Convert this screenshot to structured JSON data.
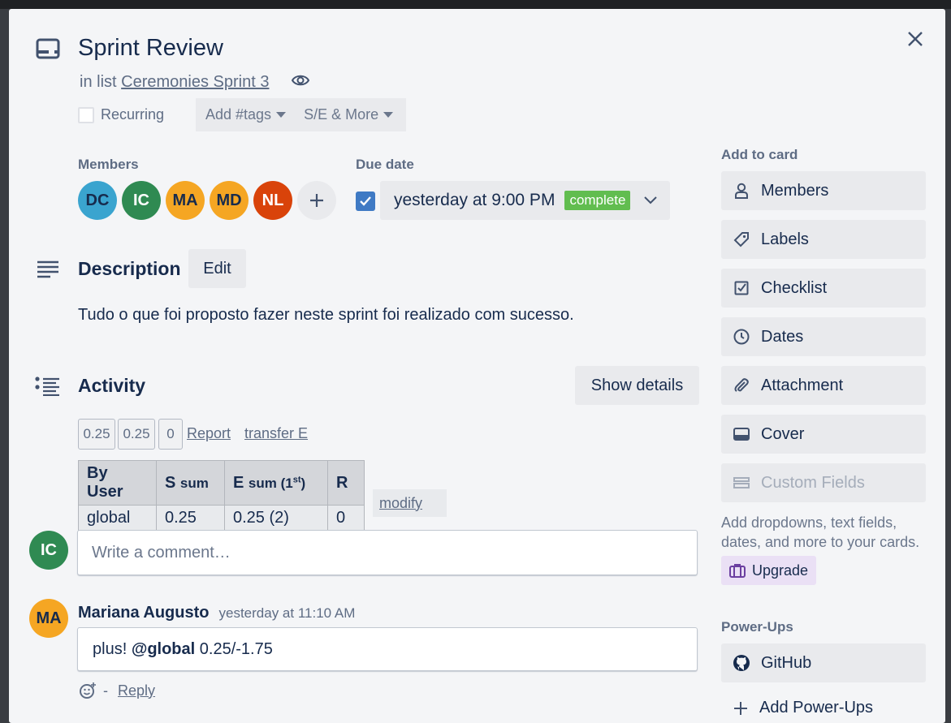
{
  "card": {
    "title": "Sprint Review",
    "in_list_prefix": "in list",
    "list_name": "Ceremonies Sprint 3",
    "recurring_label": "Recurring",
    "tags_label": "Add #tags",
    "se_label": "S/E & More"
  },
  "members": {
    "heading": "Members",
    "list": [
      {
        "initials": "DC",
        "color": "#3aa4cf"
      },
      {
        "initials": "IC",
        "color": "#2f8a52"
      },
      {
        "initials": "MA",
        "color": "#f5a623"
      },
      {
        "initials": "MD",
        "color": "#f5a623"
      },
      {
        "initials": "NL",
        "color": "#d9430a"
      }
    ]
  },
  "due": {
    "heading": "Due date",
    "value": "yesterday at 9:00 PM",
    "status": "complete"
  },
  "description": {
    "heading": "Description",
    "edit_label": "Edit",
    "text": "Tudo o que foi proposto fazer neste sprint foi realizado com sucesso."
  },
  "activity": {
    "heading": "Activity",
    "show_details_label": "Show details",
    "chips": [
      "0.25",
      "0.25",
      "0"
    ],
    "report_label": "Report",
    "transfer_label": "transfer E",
    "table": {
      "headers": {
        "by_user": "By User",
        "s_main": "S",
        "s_sub": "sum",
        "e_main": "E",
        "e_sub": "sum (1",
        "e_sup": "st",
        "e_close": ")",
        "r": "R"
      },
      "rows": [
        {
          "user": "global",
          "s": "0.25",
          "e": "0.25 (2)",
          "r": "0"
        }
      ],
      "modify_label": "modify"
    },
    "comment_avatar": "IC",
    "comment_placeholder": "Write a comment…"
  },
  "comment": {
    "avatar": "MA",
    "author": "Mariana Augusto",
    "time": "yesterday at 11:10 AM",
    "text_prefix": "plus!",
    "mention": "@global",
    "text_suffix": "0.25/-1.75",
    "dash": "-",
    "reply_label": "Reply"
  },
  "sidebar": {
    "add_to_card_heading": "Add to card",
    "buttons": [
      {
        "label": "Members",
        "icon": "person-icon"
      },
      {
        "label": "Labels",
        "icon": "tag-icon"
      },
      {
        "label": "Checklist",
        "icon": "checklist-icon"
      },
      {
        "label": "Dates",
        "icon": "clock-icon"
      },
      {
        "label": "Attachment",
        "icon": "paperclip-icon"
      },
      {
        "label": "Cover",
        "icon": "cover-icon"
      },
      {
        "label": "Custom Fields",
        "icon": "custom-fields-icon"
      }
    ],
    "custom_fields_note": "Add dropdowns, text fields, dates, and more to your cards.",
    "upgrade_label": "Upgrade",
    "powerups_heading": "Power-Ups",
    "github_label": "GitHub",
    "add_powerups_label": "Add Power-Ups"
  }
}
